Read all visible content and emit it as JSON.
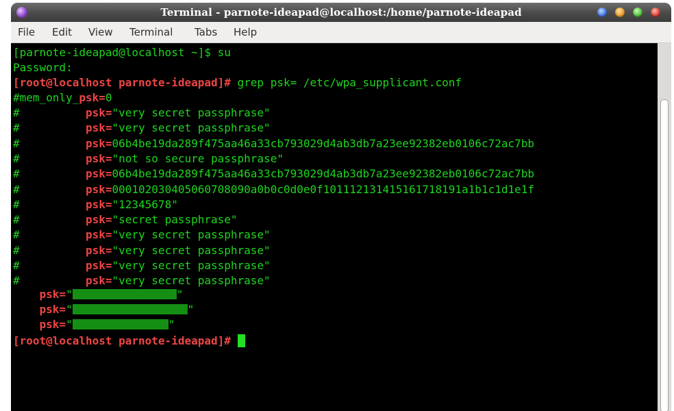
{
  "window": {
    "title": "Terminal - parnote-ideapad@localhost:/home/parnote-ideapad"
  },
  "menu": [
    "File",
    "Edit",
    "View",
    "Terminal",
    "Tabs",
    "Help"
  ],
  "terminal": {
    "line1": {
      "prompt": "[parnote-ideapad@localhost ~]$",
      "command": " su"
    },
    "line2": "Password:",
    "line3": {
      "prompt": "[root@localhost parnote-ideapad]#",
      "command": " grep psk= /etc/wpa_supplicant.conf"
    },
    "line4": {
      "prefix": "#mem_only_",
      "key": "psk=",
      "value": "0"
    },
    "comment_lines": [
      {
        "hash": "#",
        "key": "psk=",
        "value": "\"very secret passphrase\""
      },
      {
        "hash": "#",
        "key": "psk=",
        "value": "\"very secret passphrase\""
      },
      {
        "hash": "#",
        "key": "psk=",
        "value": "06b4be19da289f475aa46a33cb793029d4ab3db7a23ee92382eb0106c72ac7bb"
      },
      {
        "hash": "#",
        "key": "psk=",
        "value": "\"not so secure passphrase\""
      },
      {
        "hash": "#",
        "key": "psk=",
        "value": "06b4be19da289f475aa46a33cb793029d4ab3db7a23ee92382eb0106c72ac7bb"
      },
      {
        "hash": "#",
        "key": "psk=",
        "value": "000102030405060708090a0b0c0d0e0f101112131415161718191a1b1c1d1e1f"
      },
      {
        "hash": "#",
        "key": "psk=",
        "value": "\"12345678\""
      },
      {
        "hash": "#",
        "key": "psk=",
        "value": "\"secret passphrase\""
      },
      {
        "hash": "#",
        "key": "psk=",
        "value": "\"very secret passphrase\""
      },
      {
        "hash": "#",
        "key": "psk=",
        "value": "\"very secret passphrase\""
      },
      {
        "hash": "#",
        "key": "psk=",
        "value": "\"very secret passphrase\""
      },
      {
        "hash": "#",
        "key": "psk=",
        "value": "\"very secret passphrase\""
      }
    ],
    "redacted_lines": [
      {
        "key": "psk=",
        "open_quote": "\"",
        "close_quote": "\""
      },
      {
        "key": "psk=",
        "open_quote": "\"",
        "close_quote": "\""
      },
      {
        "key": "psk=",
        "open_quote": "\"",
        "close_quote": "\""
      }
    ],
    "final_prompt": "[root@localhost parnote-ideapad]#"
  },
  "colors": {
    "foreground": "#1ed61e",
    "prompt_root": "#ee4545",
    "background": "#000000",
    "redaction": "#148f14"
  }
}
